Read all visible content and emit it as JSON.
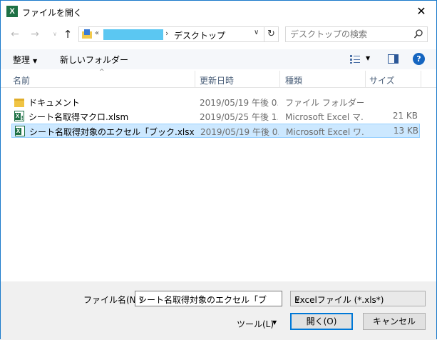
{
  "titlebar": {
    "title": "ファイルを開く",
    "app_icon_letter": "X",
    "close_glyph": "✕"
  },
  "nav": {
    "back_glyph": "←",
    "forward_glyph": "→",
    "dropdown_glyph": "∨",
    "up_glyph": "↑",
    "address_prefix": "«",
    "address_separator": "›",
    "address_folder": "デスクトップ",
    "address_chevron": "∨",
    "refresh_glyph": "↻",
    "search_placeholder": "デスクトップの検索"
  },
  "toolbar": {
    "organize_label": "整理",
    "organize_caret": "▼",
    "new_folder_label": "新しいフォルダー",
    "view_caret": "▼",
    "help_label": "?"
  },
  "columns": {
    "sort_arrow": "^",
    "name": "名前",
    "date": "更新日時",
    "type": "種類",
    "size": "サイズ"
  },
  "files": [
    {
      "name": "ドキュメント",
      "date": "2019/05/19 午後 0...",
      "type": "ファイル フォルダー",
      "size": "",
      "icon": "folder-icon",
      "selected": false
    },
    {
      "name": "シート名取得マクロ.xlsm",
      "date": "2019/05/25 午後 1...",
      "type": "Microsoft Excel マ...",
      "size": "21 KB",
      "icon": "excel-macro-file-icon",
      "selected": false
    },
    {
      "name": "シート名取得対象のエクセル「ブック.xlsx",
      "date": "2019/05/19 午後 0...",
      "type": "Microsoft Excel ワ...",
      "size": "13 KB",
      "icon": "excel-file-icon",
      "selected": true
    }
  ],
  "footer": {
    "filename_label": "ファイル名(N):",
    "filename_value": "シート名取得対象のエクセル「ブック.xlsx",
    "filename_caret": "∨",
    "filter_value": "Excelファイル (*.xls*)",
    "filter_caret": "∨",
    "tools_label": "ツール(L)",
    "tools_caret": "▼",
    "open_label": "開く(O)",
    "cancel_label": "キャンセル"
  },
  "colors": {
    "accent": "#0078d7",
    "selection": "#cce8ff",
    "excel_green": "#1e7145"
  }
}
